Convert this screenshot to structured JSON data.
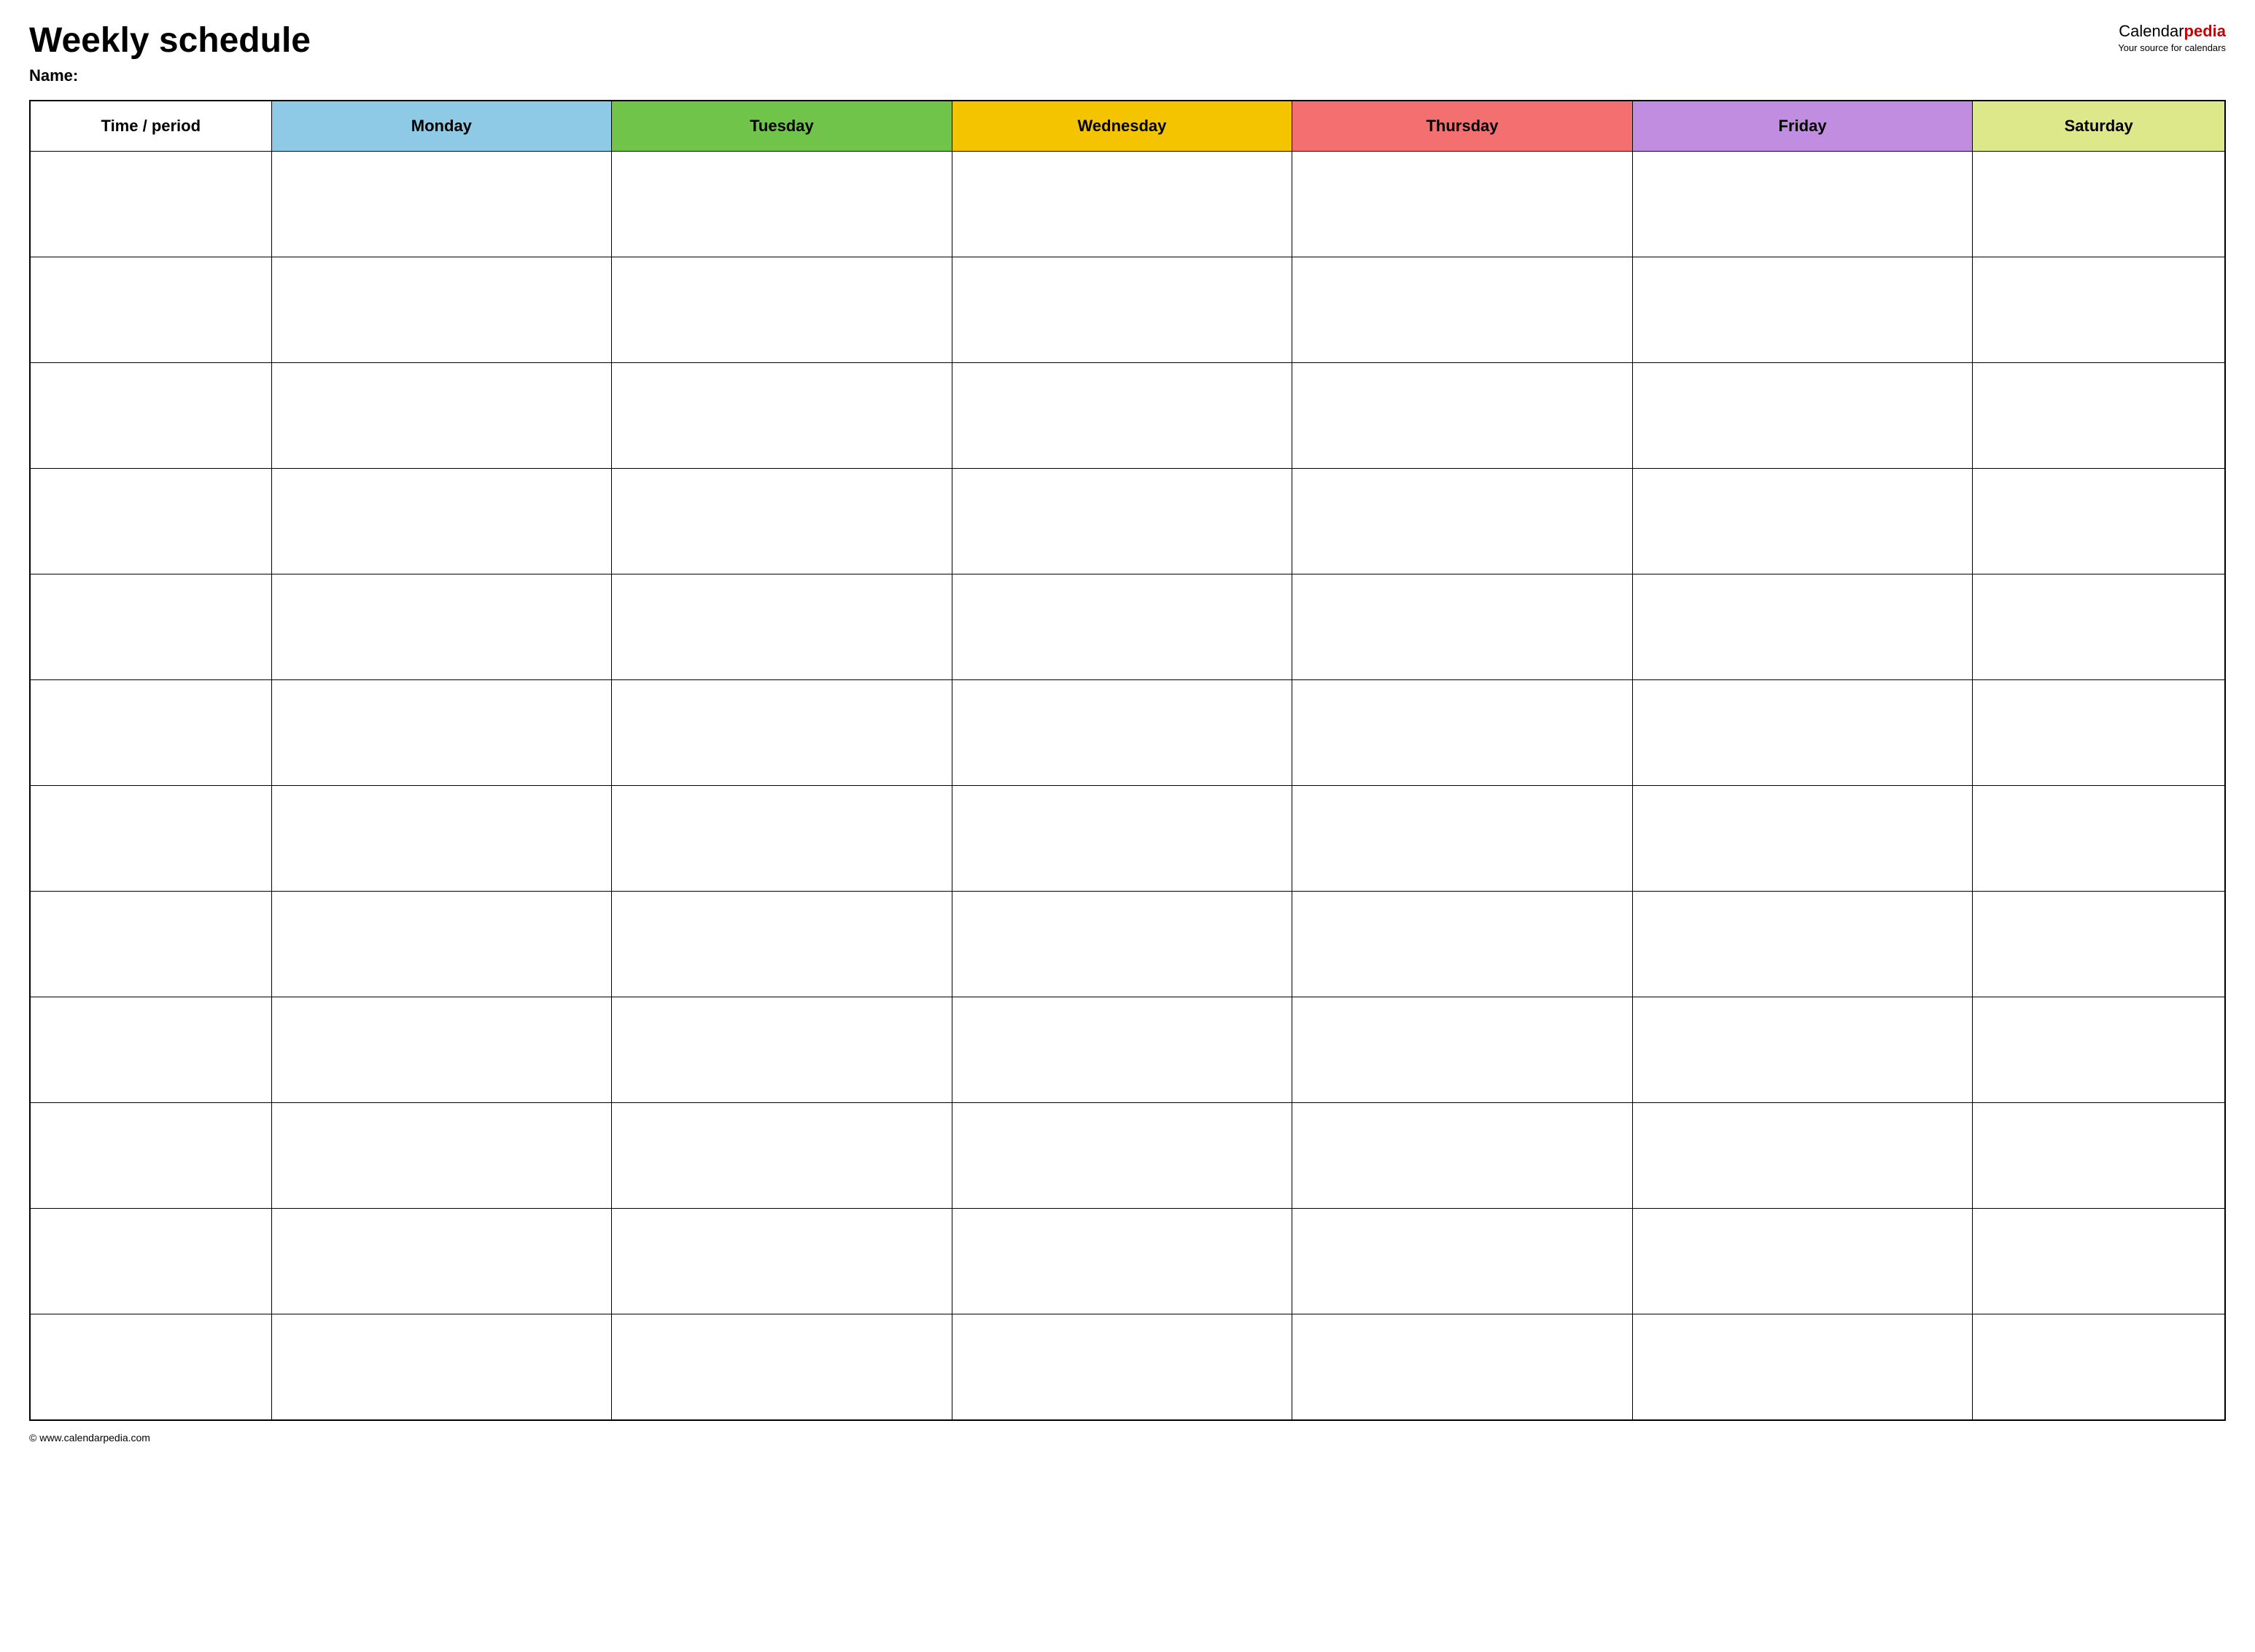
{
  "header": {
    "title": "Weekly schedule",
    "name_label": "Name:",
    "logo": {
      "calendar_text": "Calendar",
      "pedia_text": "pedia",
      "tagline": "Your source for calendars"
    }
  },
  "table": {
    "columns": [
      {
        "id": "time",
        "label": "Time / period",
        "color": "#ffffff",
        "class": "th-time"
      },
      {
        "id": "monday",
        "label": "Monday",
        "color": "#8ecae6",
        "class": "th-monday"
      },
      {
        "id": "tuesday",
        "label": "Tuesday",
        "color": "#70c44a",
        "class": "th-tuesday"
      },
      {
        "id": "wednesday",
        "label": "Wednesday",
        "color": "#f5c400",
        "class": "th-wednesday"
      },
      {
        "id": "thursday",
        "label": "Thursday",
        "color": "#f47070",
        "class": "th-thursday"
      },
      {
        "id": "friday",
        "label": "Friday",
        "color": "#c08de0",
        "class": "th-friday"
      },
      {
        "id": "saturday",
        "label": "Saturday",
        "color": "#dde88a",
        "class": "th-saturday"
      }
    ],
    "row_count": 12
  },
  "footer": {
    "url": "© www.calendarpedia.com"
  }
}
